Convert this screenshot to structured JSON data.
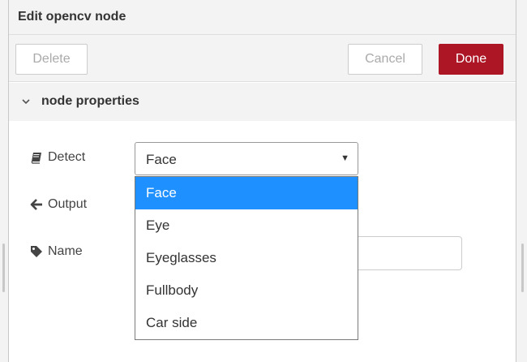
{
  "tray": {
    "title": "Edit opencv node"
  },
  "toolbar": {
    "delete_label": "Delete",
    "cancel_label": "Cancel",
    "done_label": "Done"
  },
  "section": {
    "label": "node properties",
    "expanded": true
  },
  "form": {
    "detect_label": "Detect",
    "detect_icon": "book-icon",
    "output_label": "Output",
    "output_icon": "arrow-left-icon",
    "name_label": "Name",
    "name_icon": "tag-icon",
    "name_value": ""
  },
  "detect_select": {
    "selected": "Face",
    "options": [
      "Face",
      "Eye",
      "Eyeglasses",
      "Fullbody",
      "Car side"
    ],
    "open": true
  },
  "colors": {
    "done_button": "#ad1625",
    "option_highlight": "#1e90ff",
    "header_bg": "#f3f3f3"
  }
}
